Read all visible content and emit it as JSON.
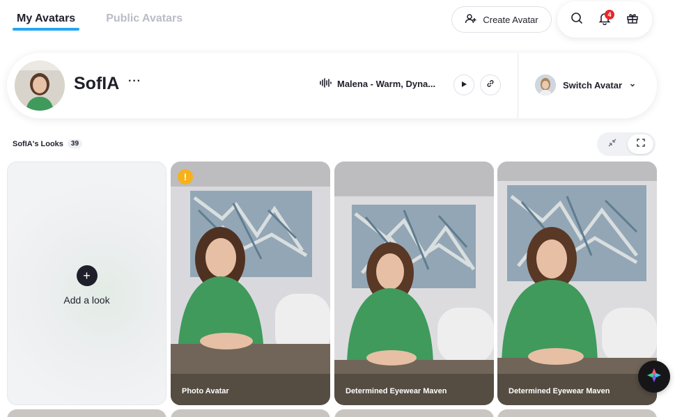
{
  "tabs": [
    {
      "label": "My Avatars",
      "active": true
    },
    {
      "label": "Public Avatars",
      "active": false
    }
  ],
  "header": {
    "create_label": "Create Avatar",
    "notification_count": "4"
  },
  "avatar": {
    "name": "SofIA",
    "more": "···",
    "voice_label": "Malena - Warm, Dyna...",
    "switch_label": "Switch Avatar"
  },
  "looks": {
    "label": "SofIA's Looks",
    "count": "39",
    "add_label": "Add a look",
    "cards": [
      {
        "title": "Photo Avatar",
        "warning": true
      },
      {
        "title": "Determined Eyewear Maven",
        "warning": false
      },
      {
        "title": "Determined Eyewear Maven",
        "warning": false
      }
    ]
  },
  "colors": {
    "accent": "#23a6f0",
    "badge": "#e8262b",
    "warning": "#f7b21b",
    "shirt": "#3f9a5c"
  },
  "icons": [
    "user-plus-icon",
    "search-icon",
    "bell-icon",
    "gift-icon",
    "waveform-icon",
    "play-icon",
    "link-icon",
    "chevron-down-icon",
    "collapse-icon",
    "expand-icon",
    "plus-icon",
    "warning-icon",
    "assistant-icon"
  ]
}
